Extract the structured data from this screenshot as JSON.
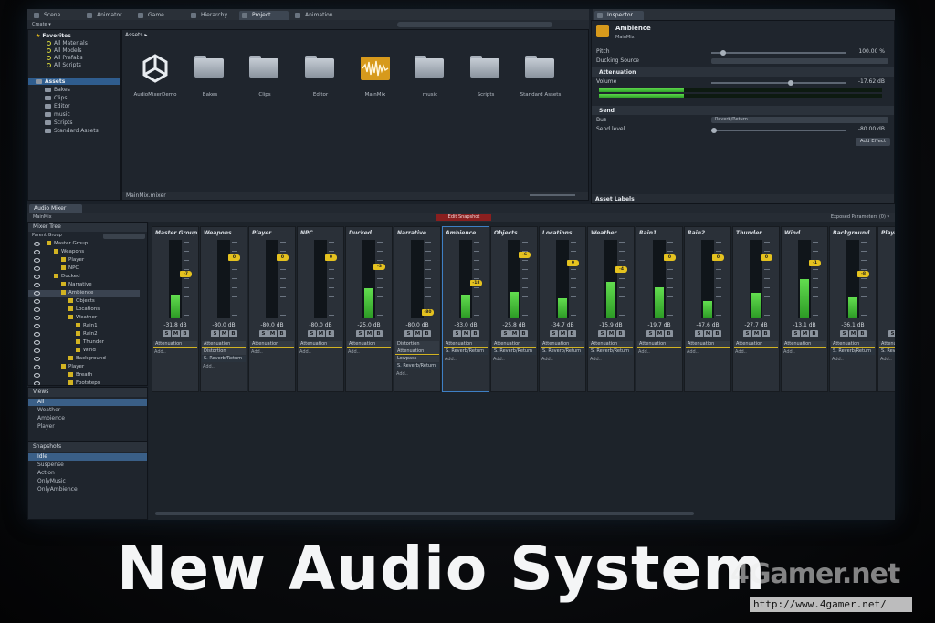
{
  "top_tabs": [
    "Scene",
    "Animator",
    "Game",
    "Hierarchy",
    "Project",
    "Animation"
  ],
  "inspector_tab": "Inspector",
  "project": {
    "create_label": "Create ▾",
    "favorites": {
      "title": "Favorites",
      "items": [
        "All Materials",
        "All Models",
        "All Prefabs",
        "All Scripts"
      ]
    },
    "assets_tree": {
      "title": "Assets",
      "items": [
        "Bakes",
        "Clips",
        "Editor",
        "music",
        "Scripts",
        "Standard Assets"
      ]
    },
    "breadcrumb": "Assets ▸",
    "assets": [
      {
        "label": "AudioMixerDemo",
        "icon": "unity-logo-icon"
      },
      {
        "label": "Bakes",
        "icon": "folder-icon"
      },
      {
        "label": "Clips",
        "icon": "folder-icon"
      },
      {
        "label": "Editor",
        "icon": "folder-icon"
      },
      {
        "label": "MainMix",
        "icon": "audio-mixer-icon"
      },
      {
        "label": "music",
        "icon": "folder-icon"
      },
      {
        "label": "Scripts",
        "icon": "folder-icon"
      },
      {
        "label": "Standard Assets",
        "icon": "folder-icon"
      }
    ],
    "footer": "MainMix.mixer"
  },
  "inspector": {
    "object_name": "Ambience",
    "object_sub": "MainMix",
    "pitch_label": "Pitch",
    "pitch_value": "100.00 %",
    "ducking_label": "Ducking Source",
    "attenuation_title": "Attenuation",
    "volume_label": "Volume",
    "volume_value": "-17.62 dB",
    "send_title": "Send",
    "bus_label": "Bus",
    "bus_value": "Reverb/Return",
    "send_level_label": "Send level",
    "send_level_value": "-80.00 dB",
    "add_effect": "Add Effect",
    "asset_labels": "Asset Labels"
  },
  "mixer": {
    "tab": "Audio Mixer",
    "mix_name": "MainMix",
    "edit_snapshot": "Edit Snapshot",
    "exposed_params": "Exposed Parameters (0) ▾",
    "tree_title": "Mixer Tree",
    "parent_group": "Parent Group",
    "tree": [
      {
        "label": "Master Group",
        "indent": 0
      },
      {
        "label": "Weapons",
        "indent": 1
      },
      {
        "label": "Player",
        "indent": 2
      },
      {
        "label": "NPC",
        "indent": 2
      },
      {
        "label": "Ducked",
        "indent": 1
      },
      {
        "label": "Narrative",
        "indent": 2
      },
      {
        "label": "Ambience",
        "indent": 2,
        "selected": true
      },
      {
        "label": "Objects",
        "indent": 3
      },
      {
        "label": "Locations",
        "indent": 3
      },
      {
        "label": "Weather",
        "indent": 3
      },
      {
        "label": "Rain1",
        "indent": 4
      },
      {
        "label": "Rain2",
        "indent": 4
      },
      {
        "label": "Thunder",
        "indent": 4
      },
      {
        "label": "Wind",
        "indent": 4
      },
      {
        "label": "Background",
        "indent": 3
      },
      {
        "label": "Player",
        "indent": 2
      },
      {
        "label": "Breath",
        "indent": 3
      },
      {
        "label": "Footsteps",
        "indent": 3
      }
    ],
    "views_title": "Views",
    "views": [
      "All",
      "Weather",
      "Ambience",
      "Player"
    ],
    "snapshots_title": "Snapshots",
    "snapshots": [
      "Idle",
      "Suspense",
      "Action",
      "OnlyMusic",
      "OnlyAmbience"
    ],
    "solo_mute_bypass": [
      "S",
      "M",
      "B"
    ],
    "strips": [
      {
        "name": "Master Group",
        "db": "-31.8 dB",
        "level": 0.3,
        "thumb": "-7",
        "thumb_pos": 0.42,
        "effects": [
          "Attenuation"
        ],
        "sends": []
      },
      {
        "name": "Weapons",
        "db": "-80.0 dB",
        "level": 0,
        "thumb": "0",
        "thumb_pos": 0.2,
        "effects": [
          "Attenuation",
          "Distortion"
        ],
        "sends": [
          "S. Reverb/Return"
        ]
      },
      {
        "name": "Player",
        "db": "-80.0 dB",
        "level": 0,
        "thumb": "0",
        "thumb_pos": 0.2,
        "effects": [
          "Attenuation"
        ],
        "sends": []
      },
      {
        "name": "NPC",
        "db": "-80.0 dB",
        "level": 0,
        "thumb": "0",
        "thumb_pos": 0.2,
        "effects": [
          "Attenuation"
        ],
        "sends": []
      },
      {
        "name": "Ducked",
        "db": "-25.0 dB",
        "level": 0.38,
        "thumb": "-3",
        "thumb_pos": 0.33,
        "effects": [
          "Attenuation"
        ],
        "sends": []
      },
      {
        "name": "Narrative",
        "db": "-80.0 dB",
        "level": 0,
        "thumb": "-80",
        "thumb_pos": 0.95,
        "effects": [
          "Distortion",
          "Attenuation",
          "Lowpass"
        ],
        "sends": [
          "S. Reverb/Return"
        ]
      },
      {
        "name": "Ambience",
        "db": "-33.0 dB",
        "level": 0.3,
        "thumb": "-18",
        "thumb_pos": 0.55,
        "effects": [
          "Attenuation"
        ],
        "sends": [
          "S. Reverb/Return"
        ],
        "active": true
      },
      {
        "name": "Objects",
        "db": "-25.8 dB",
        "level": 0.34,
        "thumb": "-6",
        "thumb_pos": 0.16,
        "effects": [
          "Attenuation"
        ],
        "sends": [
          "S. Reverb/Return"
        ]
      },
      {
        "name": "Locations",
        "db": "-34.7 dB",
        "level": 0.26,
        "thumb": "0",
        "thumb_pos": 0.28,
        "effects": [
          "Attenuation"
        ],
        "sends": [
          "S. Reverb/Return"
        ]
      },
      {
        "name": "Weather",
        "db": "-15.9 dB",
        "level": 0.46,
        "thumb": "-4",
        "thumb_pos": 0.36,
        "effects": [
          "Attenuation"
        ],
        "sends": [
          "S. Reverb/Return"
        ]
      },
      {
        "name": "Rain1",
        "db": "-19.7 dB",
        "level": 0.4,
        "thumb": "0",
        "thumb_pos": 0.2,
        "effects": [
          "Attenuation"
        ],
        "sends": []
      },
      {
        "name": "Rain2",
        "db": "-47.6 dB",
        "level": 0.22,
        "thumb": "0",
        "thumb_pos": 0.2,
        "effects": [
          "Attenuation"
        ],
        "sends": []
      },
      {
        "name": "Thunder",
        "db": "-27.7 dB",
        "level": 0.33,
        "thumb": "0",
        "thumb_pos": 0.2,
        "effects": [
          "Attenuation"
        ],
        "sends": []
      },
      {
        "name": "Wind",
        "db": "-13.1 dB",
        "level": 0.5,
        "thumb": "-1",
        "thumb_pos": 0.28,
        "effects": [
          "Attenuation"
        ],
        "sends": []
      },
      {
        "name": "Background",
        "db": "-36.1 dB",
        "level": 0.27,
        "thumb": "-8",
        "thumb_pos": 0.43,
        "effects": [
          "Attenuation"
        ],
        "sends": [
          "S. Reverb/Return"
        ]
      },
      {
        "name": "Player",
        "db": "",
        "level": 0,
        "thumb": "",
        "thumb_pos": 0.2,
        "effects": [
          "Attenuation"
        ],
        "sends": [
          "S. Reverb/Return"
        ]
      }
    ],
    "add_label": "Add.."
  },
  "headline": "New Audio System",
  "watermark": {
    "logo": "4Gamer.net",
    "url": "http://www.4gamer.net/"
  }
}
